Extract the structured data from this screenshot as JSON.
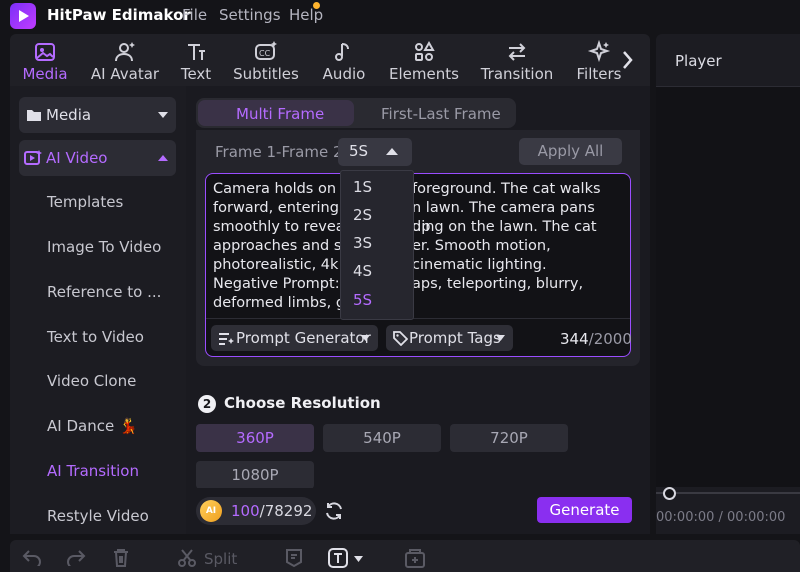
{
  "app": {
    "name": "HitPaw Edimakor"
  },
  "menu": [
    "File",
    "Settings",
    "Help"
  ],
  "toolbar": {
    "items": [
      {
        "label": "Media",
        "icon": "media-icon",
        "active": true
      },
      {
        "label": "AI Avatar",
        "icon": "ai-avatar-icon"
      },
      {
        "label": "Text",
        "icon": "text-icon"
      },
      {
        "label": "Subtitles",
        "icon": "subtitles-icon"
      },
      {
        "label": "Audio",
        "icon": "audio-icon"
      },
      {
        "label": "Elements",
        "icon": "elements-icon"
      },
      {
        "label": "Transition",
        "icon": "transition-icon"
      },
      {
        "label": "Filters",
        "icon": "filters-icon"
      }
    ]
  },
  "sidebar": {
    "media_label": "Media",
    "ai_video_label": "AI Video",
    "items": [
      {
        "label": "Templates"
      },
      {
        "label": "Image To Video"
      },
      {
        "label": "Reference to ..."
      },
      {
        "label": "Text to Video"
      },
      {
        "label": "Video Clone"
      },
      {
        "label": "AI Dance 💃"
      },
      {
        "label": "AI Transition",
        "active": true
      },
      {
        "label": "Restyle Video"
      }
    ]
  },
  "tabs": {
    "multi_frame": "Multi Frame",
    "first_last": "First-Last Frame"
  },
  "frame": {
    "label": "Frame 1-Frame 2",
    "duration": "5S",
    "apply_all": "Apply All",
    "duration_options": [
      "1S",
      "2S",
      "3S",
      "4S",
      "5S"
    ],
    "selected_option": "5S"
  },
  "prompt": {
    "lines": [
      " Camera holds on a",
      "foreground. The cat walks",
      "forward, entering a",
      "n lawn. The camera pans up",
      "smoothly to reveal",
      "ding on the lawn. The cat",
      "approaches and sit",
      "er. Smooth motion,",
      "photorealistic, 4k r",
      "cinematic lighting.",
      "Negative Prompt: s",
      "aps, teleporting, blurry,",
      "deformed limbs, g"
    ],
    "generator_label": "Prompt Generator",
    "tags_label": "Prompt Tags",
    "count_used": "344",
    "count_total": "/2000"
  },
  "resolution": {
    "step": "2",
    "title": "Choose Resolution",
    "options": [
      "360P",
      "540P",
      "720P",
      "1080P"
    ],
    "selected": "360P"
  },
  "credits": {
    "badge": "AI",
    "used": "100",
    "total": "/78292"
  },
  "generate_label": "Generate",
  "player": {
    "title": "Player",
    "time": "00:00:00 / 00:00:00"
  },
  "timeline": {
    "split_label": "Split"
  },
  "colors": {
    "accent": "#b46bff",
    "primary_button": "#8a2ff0",
    "prompt_border": "#9a4dff"
  }
}
